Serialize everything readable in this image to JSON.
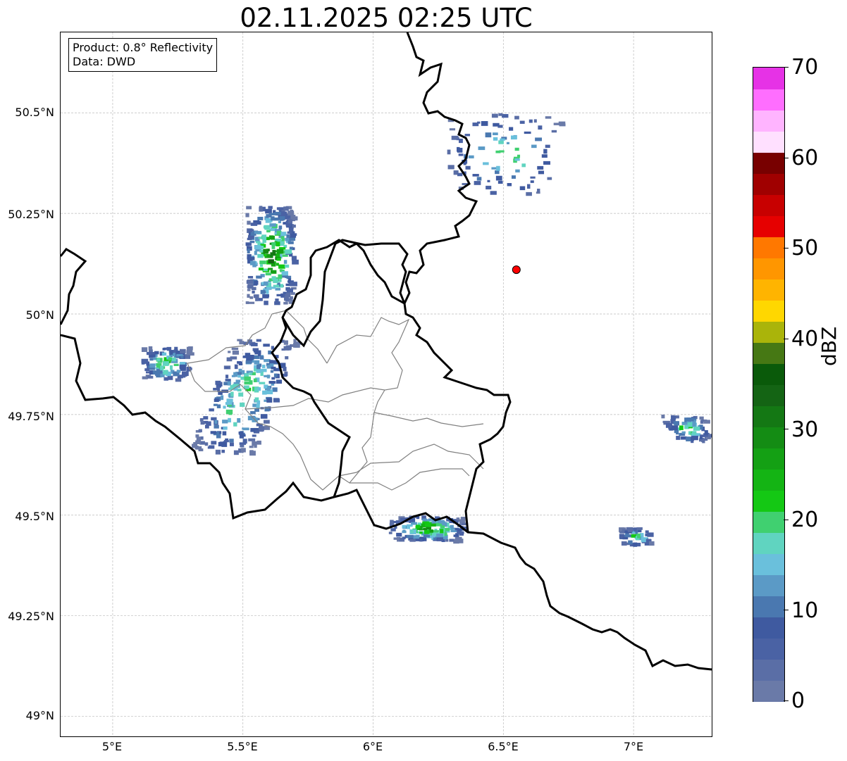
{
  "title": "02.11.2025 02:25 UTC",
  "info_box": {
    "product": "Product: 0.8° Reflectivity",
    "data": "Data: DWD"
  },
  "map": {
    "lon_range": [
      4.8,
      7.3
    ],
    "lat_range": [
      48.95,
      50.7
    ],
    "lat_ticks": [
      "50.5°N",
      "50.25°N",
      "50°N",
      "49.75°N",
      "49.5°N",
      "49.25°N",
      "49°N"
    ],
    "lon_ticks": [
      "5°E",
      "5.5°E",
      "6°E",
      "6.5°E",
      "7°E"
    ],
    "grid": true,
    "radar_site_marker": {
      "lon": 6.55,
      "lat": 50.11,
      "color": "#ff0000"
    },
    "colors": {
      "country_border": "#000000",
      "region_border": "#808080"
    }
  },
  "colorbar": {
    "label": "dBZ",
    "min": 0,
    "max": 70,
    "tick_labels": [
      "0",
      "10",
      "20",
      "30",
      "40",
      "50",
      "60",
      "70"
    ],
    "colors": [
      "#6a7aa8",
      "#5a6ea6",
      "#4a62a4",
      "#3f5aa0",
      "#4a78b0",
      "#5b9ac6",
      "#6ac0dc",
      "#60d4c0",
      "#40d070",
      "#14c814",
      "#14b414",
      "#14a014",
      "#148c14",
      "#147814",
      "#146414",
      "#0a5a0a",
      "#467814",
      "#aab40a",
      "#ffd700",
      "#ffb400",
      "#ff9600",
      "#ff7800",
      "#e60000",
      "#c80000",
      "#a00000",
      "#780000",
      "#ffe0ff",
      "#ffb4ff",
      "#ff6eff",
      "#e632e6"
    ]
  },
  "echo_cells": [
    {
      "region": "northwest-cluster",
      "center": [
        5.6,
        50.15
      ],
      "max_dbz": 40
    },
    {
      "region": "west-band",
      "center": [
        5.2,
        49.88
      ],
      "max_dbz": 30
    },
    {
      "region": "central-west-band",
      "center": [
        5.5,
        49.8
      ],
      "max_dbz": 30
    },
    {
      "region": "south-band",
      "center": [
        6.2,
        49.47
      ],
      "max_dbz": 35
    },
    {
      "region": "east-edge",
      "center": [
        7.2,
        49.72
      ],
      "max_dbz": 30
    },
    {
      "region": "southeast-cells",
      "center": [
        7.0,
        49.45
      ],
      "max_dbz": 28
    },
    {
      "region": "northeast-cells",
      "center": [
        6.5,
        50.4
      ],
      "max_dbz": 25
    }
  ]
}
